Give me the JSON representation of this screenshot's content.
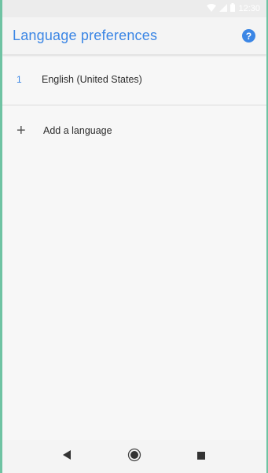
{
  "status_bar": {
    "time": "12:30",
    "wifi_icon": "wifi-icon",
    "signal_icon": "signal-icon",
    "battery_icon": "battery-icon"
  },
  "app_bar": {
    "title": "Language preferences",
    "help_icon": "help-icon",
    "help_glyph": "?"
  },
  "languages": [
    {
      "index": "1",
      "label": "English (United States)"
    }
  ],
  "add_language": {
    "icon": "add-icon",
    "glyph": "+",
    "label": "Add a language"
  },
  "nav_bar": {
    "back_icon": "back-icon",
    "home_icon": "home-icon",
    "recents_icon": "recents-icon"
  },
  "colors": {
    "accent": "#3b86e5",
    "background": "#f7f7f7",
    "frame": "#6fc3a3"
  }
}
